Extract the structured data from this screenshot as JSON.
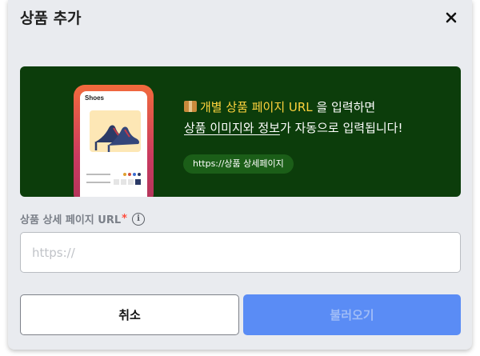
{
  "dialog": {
    "title": "상품 추가",
    "close_icon": "close-icon"
  },
  "banner": {
    "phone_screen_title": "Shoes",
    "line1_icon": "package-icon",
    "line1_highlight": "개별 상품 페이지 URL",
    "line1_rest": " 을 입력하면",
    "line2_underline": "상품 이미지와 정보",
    "line2_rest": "가 자동으로 입력됩니다!",
    "pill_text": "https://상품 상세페이지",
    "colors": {
      "background": "#0c3d0b",
      "highlight": "#ffd33d",
      "pill": "#1b5e18"
    }
  },
  "form": {
    "url_label": "상품 상세 페이지 URL",
    "required_mark": "*",
    "info_icon": "info-icon",
    "url_placeholder": "https://",
    "url_value": ""
  },
  "actions": {
    "cancel_label": "취소",
    "load_label": "불러오기",
    "colors": {
      "primary": "#5a8cf5"
    }
  }
}
